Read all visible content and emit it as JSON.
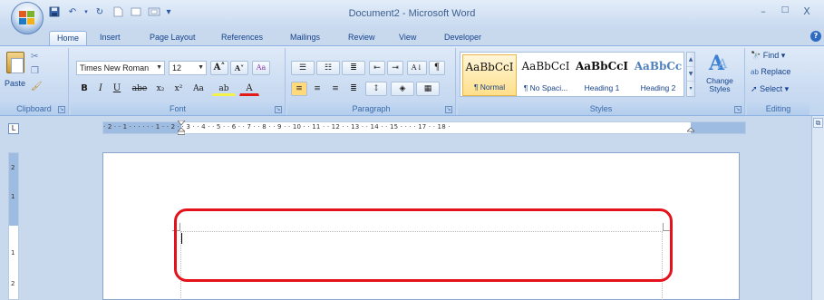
{
  "window": {
    "title": "Document2 - Microsoft Word",
    "controls": [
      "–",
      "□",
      "X"
    ]
  },
  "qat": {
    "save": "💾",
    "undo": "↶",
    "redo": "↻",
    "customize": "▾"
  },
  "tabs": [
    "Home",
    "Insert",
    "Page Layout",
    "References",
    "Mailings",
    "Review",
    "View",
    "Developer"
  ],
  "active_tab": "Home",
  "help": "?",
  "ribbon": {
    "clipboard": {
      "label": "Clipboard",
      "paste": "Paste"
    },
    "font": {
      "label": "Font",
      "font_name": "Times New Roman",
      "font_size": "12",
      "grow": "A˄",
      "shrink": "A˅",
      "clear": "Aa",
      "bold": "B",
      "italic": "I",
      "underline": "U",
      "strike": "abe",
      "subscript": "x₂",
      "superscript": "x²",
      "change_case": "Aa",
      "highlight": "ab",
      "font_color": "A"
    },
    "paragraph": {
      "label": "Paragraph",
      "sort": "A↓",
      "show_marks": "¶"
    },
    "styles": {
      "label": "Styles",
      "tiles": [
        {
          "sample": "AaBbCcI",
          "name": "¶ Normal",
          "color": "#111111",
          "bold": false
        },
        {
          "sample": "AaBbCcI",
          "name": "¶ No Spaci...",
          "color": "#111111",
          "bold": false
        },
        {
          "sample": "AaBbCcI",
          "name": "Heading 1",
          "color": "#111111",
          "bold": true
        },
        {
          "sample": "AaBbCc",
          "name": "Heading 2",
          "color": "#4f81bd",
          "bold": true
        }
      ],
      "change_styles": "Change Styles"
    },
    "editing": {
      "label": "Editing",
      "find": "Find",
      "replace": "Replace",
      "select": "Select"
    }
  },
  "ruler": {
    "corner": "L",
    "h_numbers": "· 2 · · 1 · · · · · · 1 · · 2 · · 3 · · 4 · · 5 · · 6 · · 7 · · 8 · · 9 · · 10 · · 11 · · 12 · · 13 · · 14 · · 15 · · · · 17 · · 18 ·",
    "v_numbers": [
      "2",
      "1",
      "1",
      "2"
    ]
  },
  "colors": {
    "highlight": "#e3121b",
    "ribbon": "#c8daf1"
  }
}
